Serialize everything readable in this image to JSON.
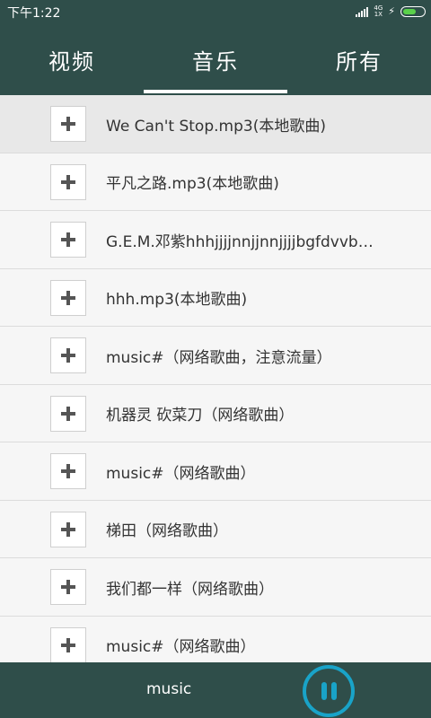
{
  "status_bar": {
    "time": "下午1:22",
    "network": "4G",
    "network_sub": "1X"
  },
  "tabs": [
    {
      "label": "视频"
    },
    {
      "label": "音乐"
    },
    {
      "label": "所有"
    }
  ],
  "selected_tab": "音乐",
  "songs": [
    {
      "title": "We Can't Stop.mp3(本地歌曲)"
    },
    {
      "title": "平凡之路.mp3(本地歌曲)"
    },
    {
      "title": "G.E.M.邓紫hhhjjjjnnjjnnjjjjbgfdvvbh..."
    },
    {
      "title": "hhh.mp3(本地歌曲)"
    },
    {
      "title": "music#（网络歌曲，注意流量）"
    },
    {
      "title": "机器灵 砍菜刀（网络歌曲）"
    },
    {
      "title": "music#（网络歌曲）"
    },
    {
      "title": "梯田（网络歌曲）"
    },
    {
      "title": "我们都一样（网络歌曲）"
    },
    {
      "title": "music#（网络歌曲）"
    }
  ],
  "player": {
    "now_playing": "music"
  },
  "colors": {
    "header_bg": "#2f4e4a",
    "accent": "#19a3c8",
    "battery": "#5ad04a"
  },
  "icons": {
    "add": "plus-icon",
    "pause": "pause-icon",
    "battery": "battery-icon",
    "signal": "signal-icon",
    "charging": "charging-icon"
  }
}
